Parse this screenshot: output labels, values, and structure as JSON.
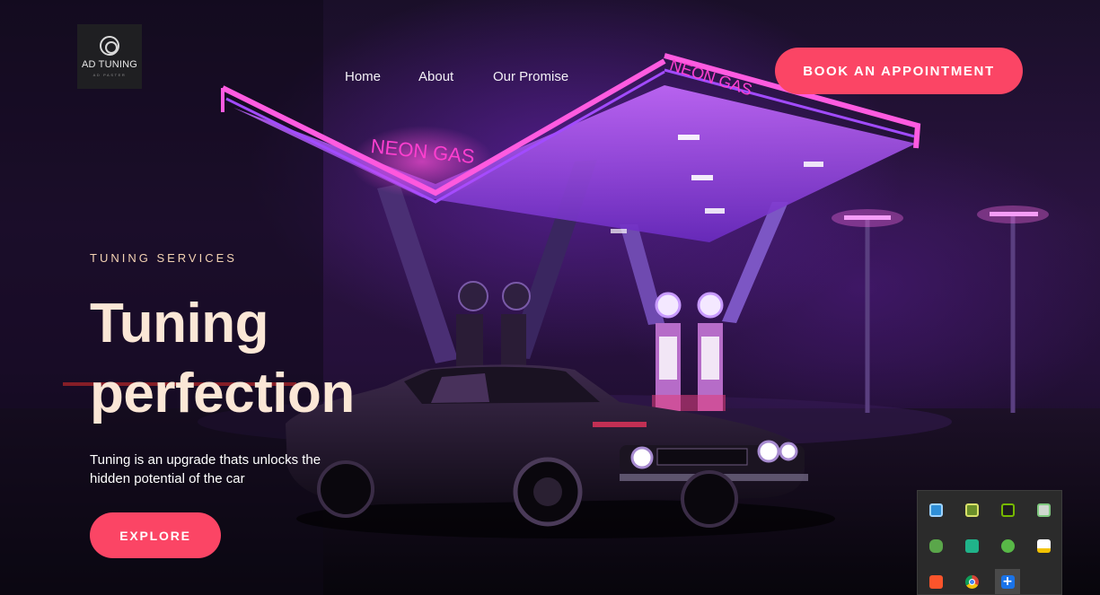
{
  "brand": {
    "name": "AD TUNING",
    "tagline": "AD PASTER"
  },
  "nav": {
    "items": [
      "Home",
      "About",
      "Our Promise"
    ],
    "cta_label": "BOOK AN APPOINTMENT"
  },
  "hero": {
    "eyebrow": "TUNING SERVICES",
    "headline_line1": "Tuning",
    "headline_line2": "perfection",
    "description": "Tuning is an upgrade thats unlocks the hidden potential of the car",
    "button_label": "EXPLORE"
  },
  "scene": {
    "canopy_sign_left": "NEON GAS",
    "canopy_sign_right": "NEON GAS"
  },
  "tray": {
    "icons": [
      "display-settings-icon",
      "gpu-monitor-icon",
      "nvidia-icon",
      "security-check-icon",
      "gamepad-icon",
      "app-c-icon",
      "utorrent-icon",
      "windows-security-warning-icon",
      "brave-icon",
      "chrome-icon",
      "add-icon"
    ]
  },
  "colors": {
    "accent": "#fb4565",
    "headline": "#fbe7d6",
    "eyebrow": "#f4d3b3",
    "neon_pink": "#ff3fd0",
    "neon_purple": "#8a3cff"
  }
}
